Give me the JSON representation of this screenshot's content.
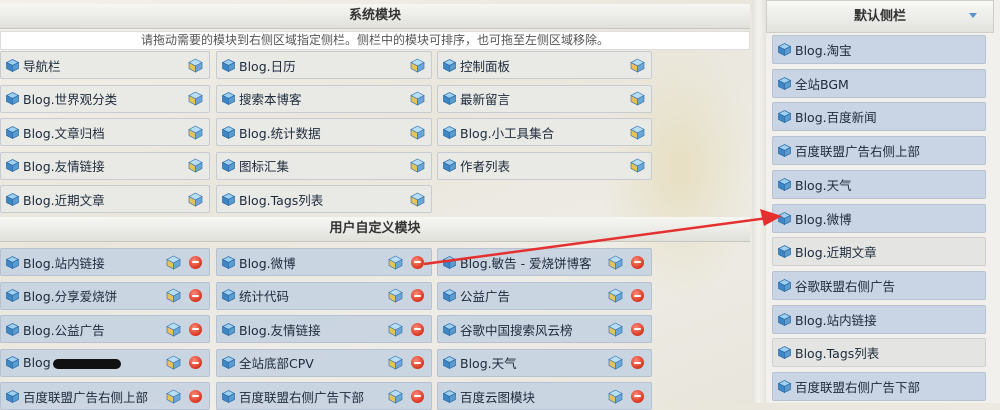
{
  "system_section": {
    "title": "系统模块",
    "hint": "请拖动需要的模块到右侧区域指定侧栏。侧栏中的模块可排序，也可拖至左侧区域移除。",
    "modules": [
      "导航栏",
      "Blog.日历",
      "控制面板",
      "Blog.世界观分类",
      "搜索本博客",
      "最新留言",
      "Blog.文章归档",
      "Blog.统计数据",
      "Blog.小工具集合",
      "Blog.友情链接",
      "图标汇集",
      "作者列表",
      "Blog.近期文章",
      "Blog.Tags列表"
    ]
  },
  "user_section": {
    "title": "用户自定义模块",
    "modules": [
      "Blog.站内链接",
      "Blog.微博",
      "Blog.敏告 - 爱烧饼博客",
      "Blog.分享爱烧饼",
      "统计代码",
      "公益广告",
      "Blog.公益广告",
      "Blog.友情链接",
      "谷歌中国搜索风云榜",
      "Blog",
      "全站底部CPV",
      "Blog.天气",
      "百度联盟广告右侧上部",
      "百度联盟右侧广告下部",
      "百度云图模块"
    ]
  },
  "sidebar": {
    "title": "默认侧栏",
    "items": [
      {
        "label": "Blog.淘宝",
        "style": "blue"
      },
      {
        "label": "全站BGM",
        "style": "blue"
      },
      {
        "label": "Blog.百度新闻",
        "style": "blue"
      },
      {
        "label": "百度联盟广告右侧上部",
        "style": "blue"
      },
      {
        "label": "Blog.天气",
        "style": "blue"
      },
      {
        "label": "Blog.微博",
        "style": "blue"
      },
      {
        "label": "Blog.近期文章",
        "style": "gray"
      },
      {
        "label": "谷歌联盟右侧广告",
        "style": "blue"
      },
      {
        "label": "Blog.站内链接",
        "style": "blue"
      },
      {
        "label": "Blog.Tags列表",
        "style": "gray"
      },
      {
        "label": "百度联盟右侧广告下部",
        "style": "blue"
      }
    ]
  },
  "icons": {
    "module_icon": "cube-icon",
    "settings_icon": "gear-cube-icon",
    "delete_icon": "minus-circle-icon",
    "collapse_icon": "chevron-down-icon"
  },
  "colors": {
    "arrow": "#e53030",
    "user_module_bg": "#c8d4e2",
    "system_module_bg": "#e8e9e6",
    "sidebar_item_bg": "#c9d5e4"
  }
}
